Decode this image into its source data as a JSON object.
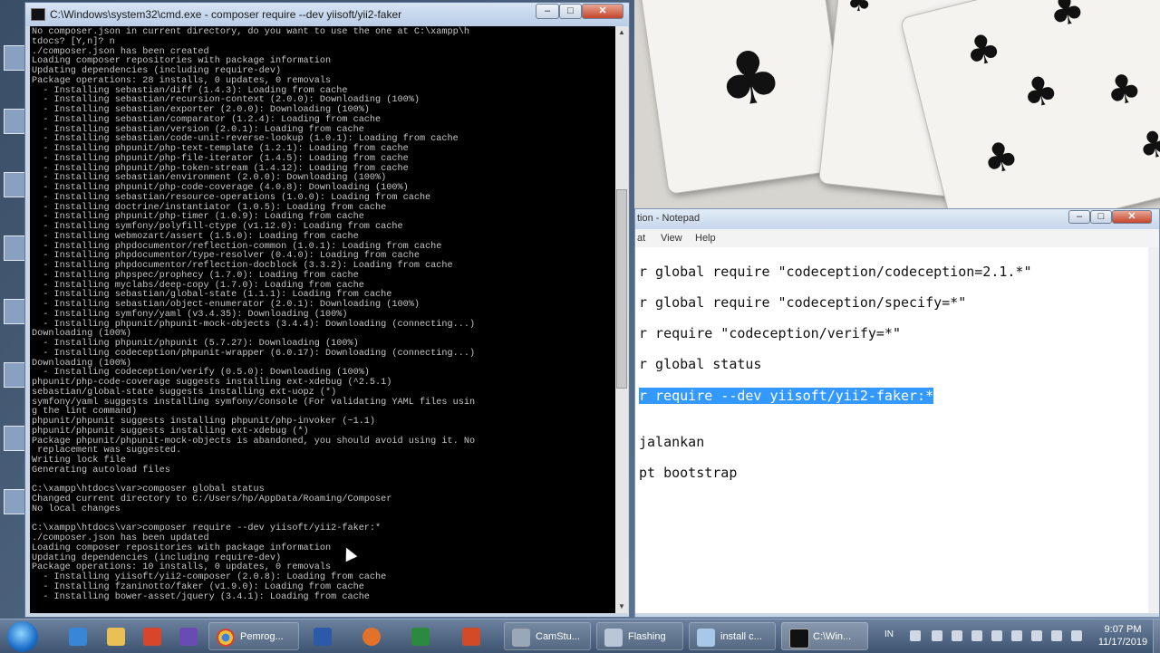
{
  "cmd": {
    "title": "C:\\Windows\\system32\\cmd.exe - composer  require --dev yiisoft/yii2-faker",
    "lines": [
      "No composer.json in current directory, do you want to use the one at C:\\xampp\\h",
      "tdocs? [Y,n]? n",
      "./composer.json has been created",
      "Loading composer repositories with package information",
      "Updating dependencies (including require-dev)",
      "Package operations: 28 installs, 0 updates, 0 removals",
      "  - Installing sebastian/diff (1.4.3): Loading from cache",
      "  - Installing sebastian/recursion-context (2.0.0): Downloading (100%)",
      "  - Installing sebastian/exporter (2.0.0): Downloading (100%)",
      "  - Installing sebastian/comparator (1.2.4): Loading from cache",
      "  - Installing sebastian/version (2.0.1): Loading from cache",
      "  - Installing sebastian/code-unit-reverse-lookup (1.0.1): Loading from cache",
      "  - Installing phpunit/php-text-template (1.2.1): Loading from cache",
      "  - Installing phpunit/php-file-iterator (1.4.5): Loading from cache",
      "  - Installing phpunit/php-token-stream (1.4.12): Loading from cache",
      "  - Installing sebastian/environment (2.0.0): Downloading (100%)",
      "  - Installing phpunit/php-code-coverage (4.0.8): Downloading (100%)",
      "  - Installing sebastian/resource-operations (1.0.0): Loading from cache",
      "  - Installing doctrine/instantiator (1.0.5): Loading from cache",
      "  - Installing phpunit/php-timer (1.0.9): Loading from cache",
      "  - Installing symfony/polyfill-ctype (v1.12.0): Loading from cache",
      "  - Installing webmozart/assert (1.5.0): Loading from cache",
      "  - Installing phpdocumentor/reflection-common (1.0.1): Loading from cache",
      "  - Installing phpdocumentor/type-resolver (0.4.0): Loading from cache",
      "  - Installing phpdocumentor/reflection-docblock (3.3.2): Loading from cache",
      "  - Installing phpspec/prophecy (1.7.0): Loading from cache",
      "  - Installing myclabs/deep-copy (1.7.0): Loading from cache",
      "  - Installing sebastian/global-state (1.1.1): Loading from cache",
      "  - Installing sebastian/object-enumerator (2.0.1): Downloading (100%)",
      "  - Installing symfony/yaml (v3.4.35): Downloading (100%)",
      "  - Installing phpunit/phpunit-mock-objects (3.4.4): Downloading (connecting...)",
      "Downloading (100%)",
      "  - Installing phpunit/phpunit (5.7.27): Downloading (100%)",
      "  - Installing codeception/phpunit-wrapper (6.0.17): Downloading (connecting...)",
      "Downloading (100%)",
      "  - Installing codeception/verify (0.5.0): Downloading (100%)",
      "phpunit/php-code-coverage suggests installing ext-xdebug (^2.5.1)",
      "sebastian/global-state suggests installing ext-uopz (*)",
      "symfony/yaml suggests installing symfony/console (For validating YAML files usin",
      "g the lint command)",
      "phpunit/phpunit suggests installing phpunit/php-invoker (~1.1)",
      "phpunit/phpunit suggests installing ext-xdebug (*)",
      "Package phpunit/phpunit-mock-objects is abandoned, you should avoid using it. No",
      " replacement was suggested.",
      "Writing lock file",
      "Generating autoload files",
      "",
      "C:\\xampp\\htdocs\\var>composer global status",
      "Changed current directory to C:/Users/hp/AppData/Roaming/Composer",
      "No local changes",
      "",
      "C:\\xampp\\htdocs\\var>composer require --dev yiisoft/yii2-faker:*",
      "./composer.json has been updated",
      "Loading composer repositories with package information",
      "Updating dependencies (including require-dev)",
      "Package operations: 10 installs, 0 updates, 0 removals",
      "  - Installing yiisoft/yii2-composer (2.0.8): Loading from cache",
      "  - Installing fzaninotto/faker (v1.9.0): Loading from cache",
      "  - Installing bower-asset/jquery (3.4.1): Loading from cache"
    ]
  },
  "notepad": {
    "title": "tion - Notepad",
    "menu": [
      "at",
      "View",
      "Help"
    ],
    "lines": [
      "r global require \"codeception/codeception=2.1.*\"",
      "r global require \"codeception/specify=*\"",
      "r require \"codeception/verify=*\"",
      "r global status",
      "r require --dev yiisoft/yii2-faker:*",
      "jalankan",
      "pt bootstrap"
    ],
    "selected_line_index": 4
  },
  "taskbar": {
    "items": [
      {
        "label": "",
        "icon": "ie-icon"
      },
      {
        "label": "",
        "icon": "folder-icon"
      },
      {
        "label": "",
        "icon": "pdf-icon"
      },
      {
        "label": "",
        "icon": "vs-icon"
      },
      {
        "label": "Pemrog...",
        "icon": "chrome-icon"
      },
      {
        "label": "",
        "icon": "word-icon"
      },
      {
        "label": "",
        "icon": "firefox-icon"
      },
      {
        "label": "",
        "icon": "excel-icon"
      },
      {
        "label": "",
        "icon": "powerpoint-icon"
      },
      {
        "label": "CamStu...",
        "icon": "camstudio-icon"
      },
      {
        "label": "Flashing",
        "icon": "window-icon"
      },
      {
        "label": "install c...",
        "icon": "notepad-icon"
      },
      {
        "label": "C:\\Win...",
        "icon": "cmd-icon"
      }
    ],
    "clock_time": "9:07 PM",
    "clock_date": "11/17/2019",
    "language": "IN"
  }
}
